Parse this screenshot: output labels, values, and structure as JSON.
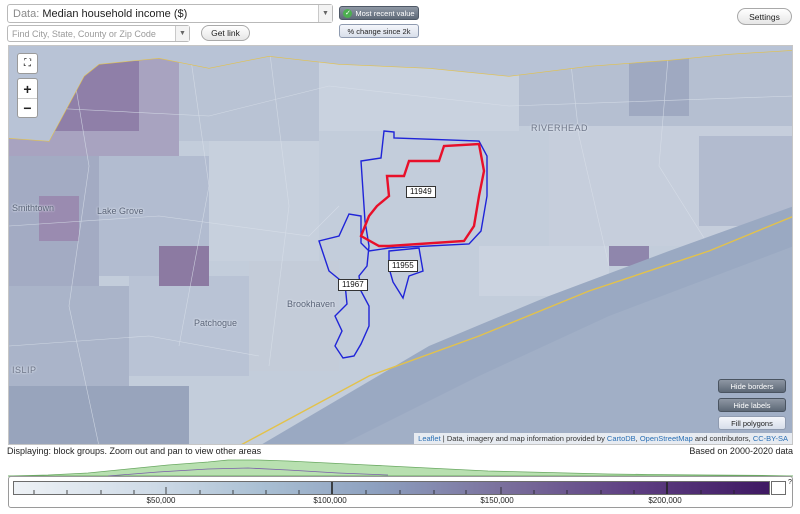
{
  "toolbar": {
    "data_prefix": "Data: ",
    "data_value": "Median household income ($)",
    "find_placeholder": "Find City, State, County or Zip Code",
    "get_link_label": "Get link",
    "settings_label": "Settings",
    "toggle_recent_label": "Most recent value",
    "toggle_change_label": "% change since 2k"
  },
  "map": {
    "places": [
      "RIVERHEAD",
      "Smithtown",
      "Lake Grove",
      "Brookhaven",
      "Patchogue",
      "ISLIP"
    ],
    "zip_labels": [
      "11949",
      "11955",
      "11967"
    ],
    "buttons": {
      "hide_borders": "Hide borders",
      "hide_labels": "Hide labels",
      "fill_polygons": "Fill polygons"
    },
    "attribution": {
      "leaflet": "Leaflet",
      "sep": " | Data, imagery and map information provided by ",
      "carto": "CartoDB",
      "comma": ", ",
      "osm": "OpenStreetMap",
      "tail": " and contributors, ",
      "license": "CC-BY-SA"
    },
    "icons": {
      "extent": "fit-extent-icon",
      "zoom_in": "zoom-in-icon",
      "zoom_out": "zoom-out-icon",
      "check": "check-icon"
    },
    "colors": {
      "boundary_blue": "#1f24d8",
      "boundary_red": "#e8102a",
      "coastline": "#e3c24a"
    }
  },
  "status": {
    "displaying": "Displaying: block groups. Zoom out and pan to view other areas",
    "based_on": "Based on 2000-2020 data"
  },
  "legend": {
    "tick_labels": [
      "$50,000",
      "$100,000",
      "$150,000",
      "$200,000"
    ],
    "question_mark": "?"
  }
}
